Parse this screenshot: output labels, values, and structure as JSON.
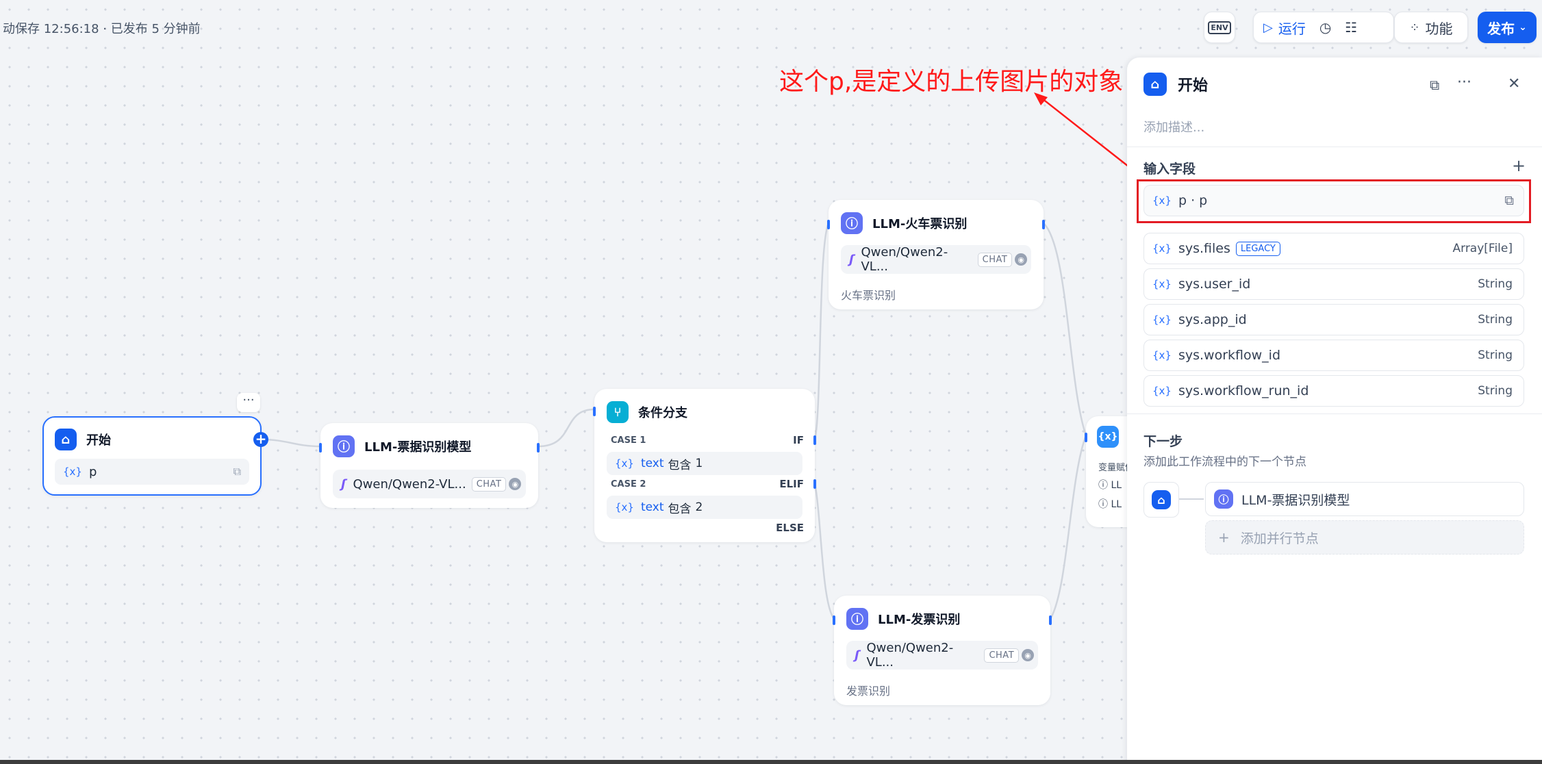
{
  "header": {
    "status": "动保存 12:56:18 · 已发布 5 分钟前",
    "env_label": "ENV",
    "run_label": "运行",
    "features_label": "功能",
    "publish_label": "发布"
  },
  "annotation": {
    "text": "这个p,是定义的上传图片的对象",
    "color": "#ff1a1a"
  },
  "nodes": {
    "start": {
      "title": "开始",
      "var_icon": "{x}",
      "var_name": "p",
      "more": "···"
    },
    "llm_ticket": {
      "title": "LLM-票据识别模型",
      "model": "Qwen/Qwen2-VL...",
      "badge": "CHAT"
    },
    "condition": {
      "title": "条件分支",
      "case1": "CASE 1",
      "if": "IF",
      "cond1_var": "text",
      "cond1_op": "包含",
      "cond1_val": "1",
      "case2": "CASE 2",
      "elif": "ELIF",
      "cond2_var": "text",
      "cond2_op": "包含",
      "cond2_val": "2",
      "else": "ELSE"
    },
    "llm_train": {
      "title": "LLM-火车票识别",
      "model": "Qwen/Qwen2-VL...",
      "badge": "CHAT",
      "desc": "火车票识别"
    },
    "llm_invoice": {
      "title": "LLM-发票识别",
      "model": "Qwen/Qwen2-VL...",
      "badge": "CHAT",
      "desc": "发票识别"
    },
    "assigner": {
      "label": "变量赋值",
      "row1": "LL",
      "row2": "LL"
    }
  },
  "panel": {
    "title": "开始",
    "description_placeholder": "添加描述...",
    "input_fields_label": "输入字段",
    "fields": [
      {
        "name": "p · p",
        "type": ""
      },
      {
        "name": "sys.files",
        "badge": "LEGACY",
        "type": "Array[File]"
      },
      {
        "name": "sys.user_id",
        "type": "String"
      },
      {
        "name": "sys.app_id",
        "type": "String"
      },
      {
        "name": "sys.workflow_id",
        "type": "String"
      },
      {
        "name": "sys.workflow_run_id",
        "type": "String"
      }
    ],
    "next_step_label": "下一步",
    "next_step_desc": "添加此工作流程中的下一个节点",
    "next_node": "LLM-票据识别模型",
    "add_parallel": "添加并行节点"
  },
  "colors": {
    "accent": "#155eef",
    "llm_icon": "#6172f3",
    "condition_icon": "#06aed4",
    "highlight_border": "#e31b23"
  }
}
